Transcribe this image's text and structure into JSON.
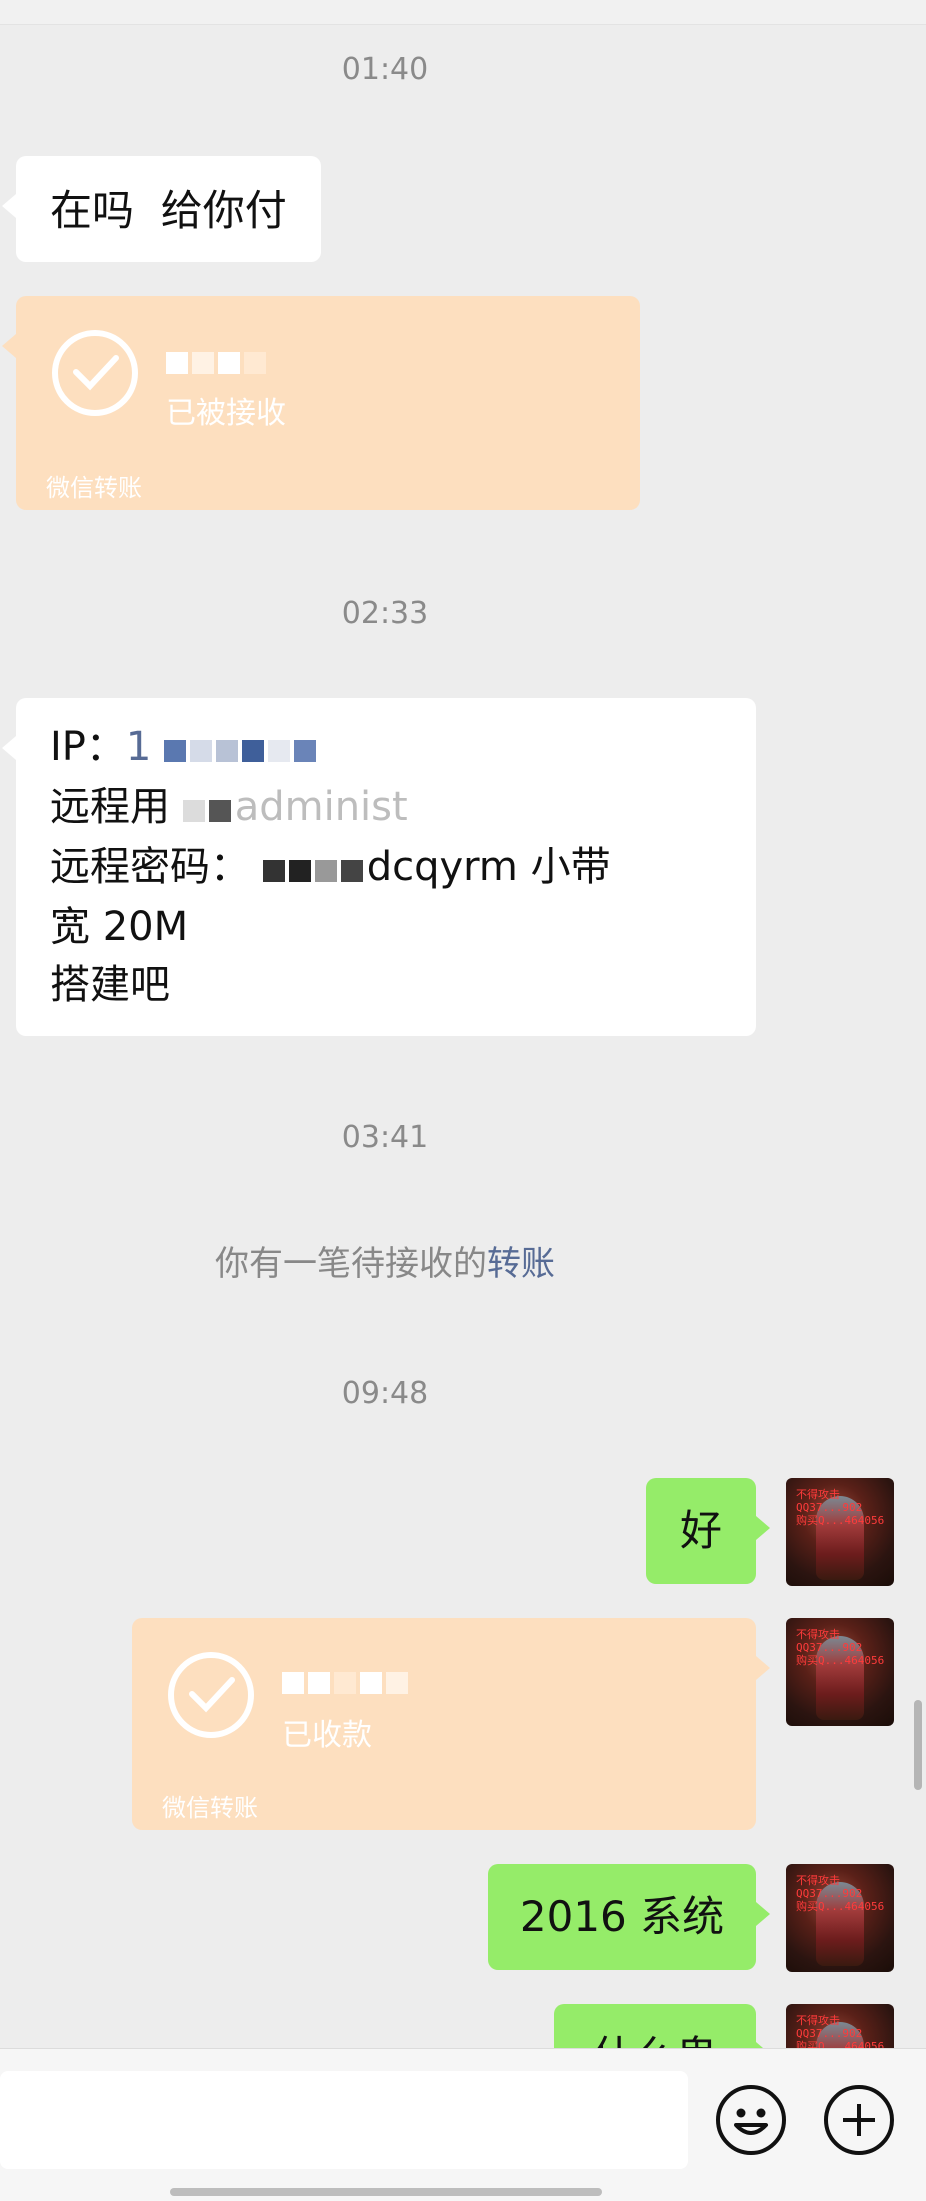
{
  "timestamps": [
    "01:40",
    "02:33",
    "03:41",
    "09:48"
  ],
  "messages": {
    "m1": "在吗  给你付",
    "m2": {
      "status": "已被接收",
      "footer": "微信转账"
    },
    "m3": {
      "line1_label": "IP：",
      "line1_value": "1",
      "line2_label": "远程用",
      "line2_value": "administ",
      "line3_label": "远程密码：",
      "line3_value": "dcqyrm  小带",
      "line4": "宽 20M",
      "line5": "搭建吧"
    },
    "system": {
      "prefix": "你有一笔待接收的",
      "link": "转账"
    },
    "m5": "好",
    "m6": {
      "status": "已收款",
      "footer": "微信转账"
    },
    "m7": "2016 系统",
    "m8": "什么鬼"
  },
  "avatar_overlay_text": "不得攻击\nQQ37...902\n购买Q...464056",
  "colors": {
    "chat_bg": "#ededed",
    "green_bubble": "#95ec69",
    "transfer_bg": "#fddfbf",
    "link": "#576b95"
  },
  "icons": [
    "emoji-icon",
    "plus-icon",
    "check-icon"
  ]
}
